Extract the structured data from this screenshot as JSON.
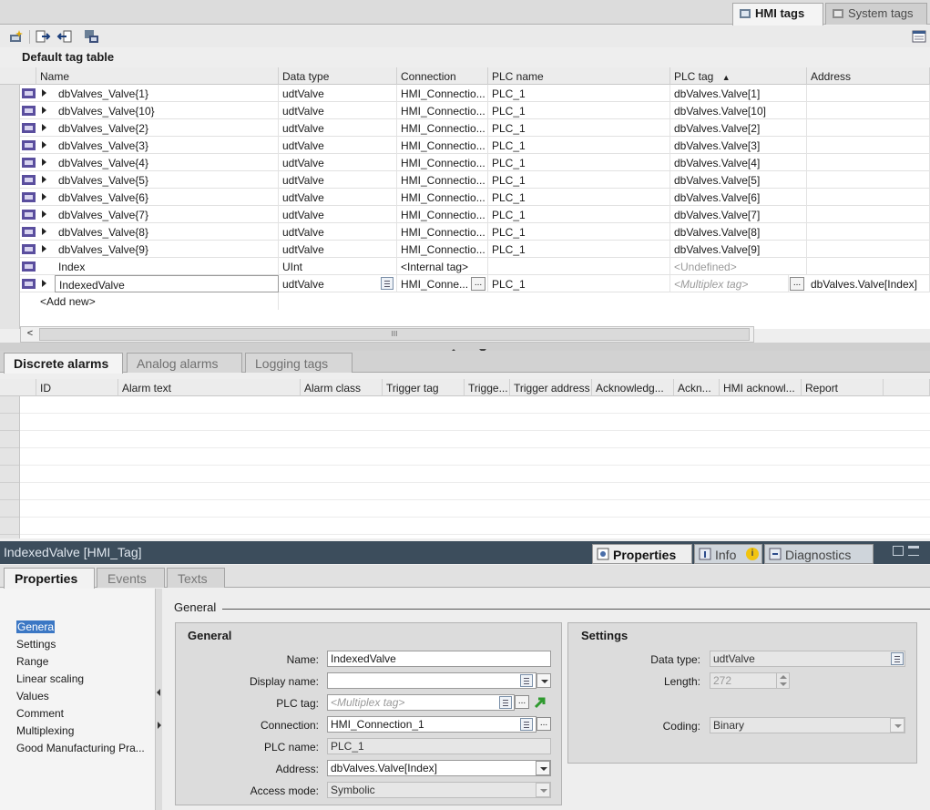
{
  "top_tabs": {
    "hmi_tags": "HMI tags",
    "system_tags": "System tags"
  },
  "tag_table": {
    "title": "Default tag table",
    "columns": [
      "Name",
      "Data type",
      "Connection",
      "PLC name",
      "PLC tag",
      "Address"
    ],
    "sort_indicator": "▲",
    "rows": [
      {
        "name": "dbValves_Valve{1}",
        "type": "udtValve",
        "conn": "HMI_Connectio...",
        "plc": "PLC_1",
        "tag": "dbValves.Valve[1]",
        "addr": ""
      },
      {
        "name": "dbValves_Valve{10}",
        "type": "udtValve",
        "conn": "HMI_Connectio...",
        "plc": "PLC_1",
        "tag": "dbValves.Valve[10]",
        "addr": ""
      },
      {
        "name": "dbValves_Valve{2}",
        "type": "udtValve",
        "conn": "HMI_Connectio...",
        "plc": "PLC_1",
        "tag": "dbValves.Valve[2]",
        "addr": ""
      },
      {
        "name": "dbValves_Valve{3}",
        "type": "udtValve",
        "conn": "HMI_Connectio...",
        "plc": "PLC_1",
        "tag": "dbValves.Valve[3]",
        "addr": ""
      },
      {
        "name": "dbValves_Valve{4}",
        "type": "udtValve",
        "conn": "HMI_Connectio...",
        "plc": "PLC_1",
        "tag": "dbValves.Valve[4]",
        "addr": ""
      },
      {
        "name": "dbValves_Valve{5}",
        "type": "udtValve",
        "conn": "HMI_Connectio...",
        "plc": "PLC_1",
        "tag": "dbValves.Valve[5]",
        "addr": ""
      },
      {
        "name": "dbValves_Valve{6}",
        "type": "udtValve",
        "conn": "HMI_Connectio...",
        "plc": "PLC_1",
        "tag": "dbValves.Valve[6]",
        "addr": ""
      },
      {
        "name": "dbValves_Valve{7}",
        "type": "udtValve",
        "conn": "HMI_Connectio...",
        "plc": "PLC_1",
        "tag": "dbValves.Valve[7]",
        "addr": ""
      },
      {
        "name": "dbValves_Valve{8}",
        "type": "udtValve",
        "conn": "HMI_Connectio...",
        "plc": "PLC_1",
        "tag": "dbValves.Valve[8]",
        "addr": ""
      },
      {
        "name": "dbValves_Valve{9}",
        "type": "udtValve",
        "conn": "HMI_Connectio...",
        "plc": "PLC_1",
        "tag": "dbValves.Valve[9]",
        "addr": ""
      }
    ],
    "index_row": {
      "name": "Index",
      "type": "UInt",
      "conn": "<Internal tag>",
      "plc": "",
      "tag": "<Undefined>",
      "addr": ""
    },
    "indexed_row": {
      "name": "IndexedValve",
      "type": "udtValve",
      "conn": "HMI_Conne...",
      "plc": "PLC_1",
      "tag": "<Multiplex tag>",
      "addr": "dbValves.Valve[Index]"
    },
    "add_new": "<Add new>",
    "ellipsis": "...",
    "scroll_left": "<",
    "scroll_grip": "III"
  },
  "alarm_tabs": [
    "Discrete alarms",
    "Analog alarms",
    "Logging tags"
  ],
  "alarm_columns": [
    "ID",
    "Alarm text",
    "Alarm class",
    "Trigger tag",
    "Trigge...",
    "Trigger address",
    "Acknowledg...",
    "Ackn...",
    "HMI acknowl...",
    "Report"
  ],
  "inspector": {
    "title": "IndexedValve [HMI_Tag]",
    "tabs": [
      "Properties",
      "Info",
      "Diagnostics"
    ],
    "info_badge": "i",
    "subtabs": [
      "Properties",
      "Events",
      "Texts"
    ],
    "nav": [
      "General",
      "Settings",
      "Range",
      "Linear scaling",
      "Values",
      "Comment",
      "Multiplexing",
      "Good Manufacturing Pra..."
    ],
    "nav_selected_label": "Genera",
    "section_title": "General",
    "general": {
      "title": "General",
      "name_label": "Name:",
      "name_value": "IndexedValve",
      "display_label": "Display name:",
      "display_value": "",
      "plctag_label": "PLC tag:",
      "plctag_value": "<Multiplex tag>",
      "connection_label": "Connection:",
      "connection_value": "HMI_Connection_1",
      "plcname_label": "PLC name:",
      "plcname_value": "PLC_1",
      "address_label": "Address:",
      "address_value": "dbValves.Valve[Index]",
      "access_label": "Access mode:",
      "access_value": "Symbolic",
      "ellipsis": "..."
    },
    "settings": {
      "title": "Settings",
      "datatype_label": "Data type:",
      "datatype_value": "udtValve",
      "length_label": "Length:",
      "length_value": "272",
      "coding_label": "Coding:",
      "coding_value": "Binary"
    }
  },
  "colors": {
    "inspector_title_bg": "#3c4d5c",
    "selection": "#3b77c4",
    "jump_arrow": "#2e9a2e"
  }
}
